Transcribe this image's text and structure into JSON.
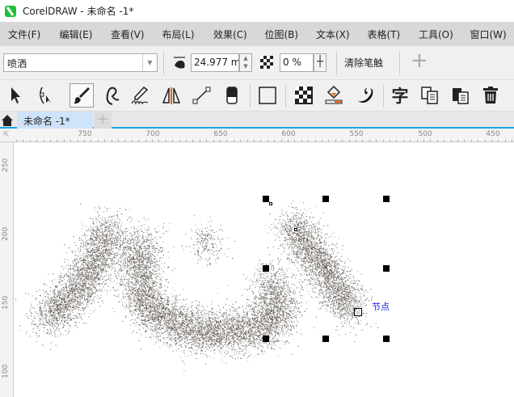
{
  "window": {
    "title": "CorelDRAW - 未命名 -1*"
  },
  "menu": [
    "文件(F)",
    "编辑(E)",
    "查看(V)",
    "布局(L)",
    "效果(C)",
    "位图(B)",
    "文本(X)",
    "表格(T)",
    "工具(O)",
    "窗口(W)"
  ],
  "propbar": {
    "brush_type": "喷洒",
    "nib_size": "24.977 mm",
    "transparency": "0 %",
    "clear_stroke": "清除笔触",
    "add": "+"
  },
  "toolbox": {
    "icons": [
      "pick-tool",
      "shape-tool",
      "artistic-media-tool",
      "freehand-tool",
      "calligraphy-tool",
      "mirror-tool",
      "line-tool",
      "eraser-tool",
      "rectangle-tool",
      "transparency-tool",
      "fill-tool",
      "effect-tool",
      "text-tool",
      "copy-tool",
      "paste-tool",
      "delete-tool"
    ],
    "active": "artistic-media-tool"
  },
  "tabs": {
    "document": "未命名 -1*",
    "add": "+"
  },
  "ruler": {
    "horizontal": [
      "750",
      "700",
      "650",
      "600",
      "550",
      "500",
      "450"
    ],
    "vertical": [
      "250",
      "200",
      "150",
      "100"
    ]
  },
  "canvas": {
    "node_label": "节点",
    "node_label_color": "#2020e0"
  }
}
